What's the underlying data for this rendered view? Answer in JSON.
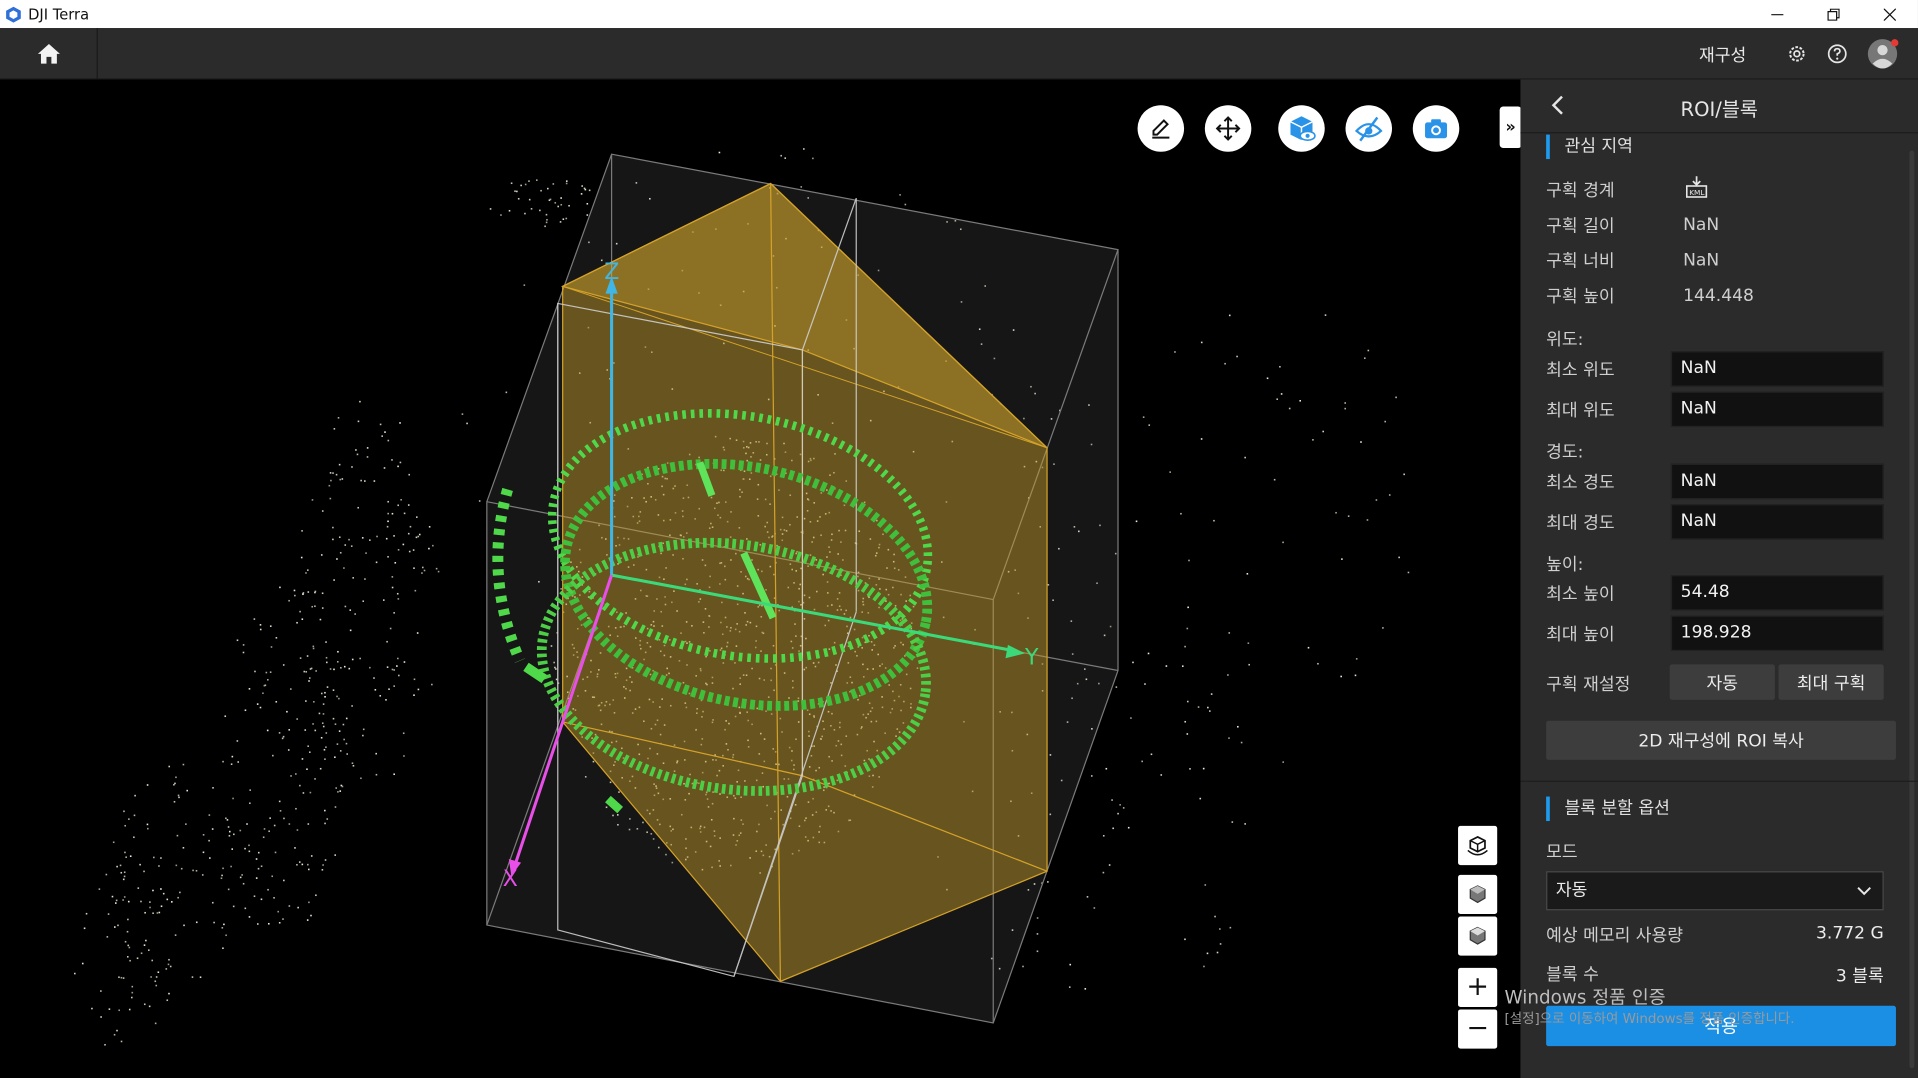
{
  "window": {
    "title": "DJI Terra",
    "accent_color": "#1e9bef"
  },
  "topbar": {
    "home_icon": "home-icon",
    "reconstruct_label": "재구성",
    "settings_icon": "gear-icon",
    "help_icon": "help-icon",
    "avatar_icon": "user-avatar-icon"
  },
  "viewport": {
    "tools": [
      {
        "name": "edit-tool",
        "icon": "pencil-icon"
      },
      {
        "name": "move-tool",
        "icon": "move-arrows-icon"
      },
      {
        "name": "roi-view-tool",
        "icon": "cube-eye-icon"
      },
      {
        "name": "visibility-tool",
        "icon": "eye-slash-icon"
      },
      {
        "name": "screenshot-tool",
        "icon": "camera-icon"
      }
    ],
    "collapse_label": "»",
    "axes": {
      "x": "X",
      "y": "Y",
      "z": "Z"
    },
    "zoom_in": "+",
    "zoom_out": "−",
    "watermark": "Windows 정품 인증",
    "watermark_sub": "[설정]으로 이동하여 Windows를 정품 인증합니다."
  },
  "panel": {
    "title": "ROI/블록",
    "roi_section": {
      "title": "관심 지역",
      "boundary_label": "구획 경계",
      "boundary_icon": "kml-import-icon",
      "length_label": "구획 길이",
      "length_value": "NaN",
      "width_label": "구획 너비",
      "width_value": "NaN",
      "height_label": "구획 높이",
      "height_value": "144.448",
      "latitude_group": "위도:",
      "min_lat_label": "최소 위도",
      "min_lat_value": "NaN",
      "max_lat_label": "최대 위도",
      "max_lat_value": "NaN",
      "longitude_group": "경도:",
      "min_lon_label": "최소 경도",
      "min_lon_value": "NaN",
      "max_lon_label": "최대 경도",
      "max_lon_value": "NaN",
      "altitude_group": "높이:",
      "min_alt_label": "최소 높이",
      "min_alt_value": "54.48",
      "max_alt_label": "최대 높이",
      "max_alt_value": "198.928",
      "reset_label": "구획 재설정",
      "auto_button": "자동",
      "max_button": "최대 구획",
      "copy_button": "2D 재구성에 ROI 복사"
    },
    "block_section": {
      "title": "블록 분할 옵션",
      "mode_label": "모드",
      "mode_value": "자동",
      "memory_label": "예상 메모리 사용량",
      "memory_value": "3.772 G",
      "blocks_label": "블록 수",
      "blocks_value": "3 블록",
      "apply_button": "적용"
    }
  }
}
